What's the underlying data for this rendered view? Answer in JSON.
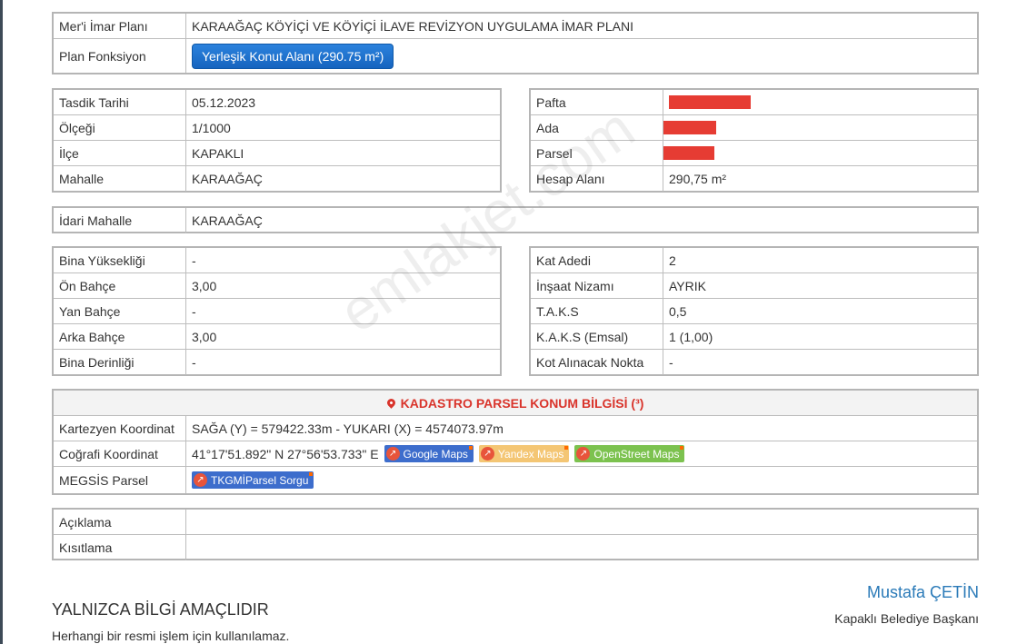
{
  "plan": {
    "name_label": "Mer'i İmar Planı",
    "name_value": "KARAAĞAÇ KÖYİÇİ VE KÖYİÇİ İLAVE REVİZYON UYGULAMA İMAR PLANI",
    "function_label": "Plan Fonksiyon",
    "function_button": "Yerleşik Konut Alanı (290.75 m²)"
  },
  "info_left": [
    {
      "label": "Tasdik Tarihi",
      "value": "05.12.2023"
    },
    {
      "label": "Ölçeği",
      "value": "1/1000"
    },
    {
      "label": "İlçe",
      "value": "KAPAKLI"
    },
    {
      "label": "Mahalle",
      "value": "KARAAĞAÇ"
    }
  ],
  "info_right": [
    {
      "label": "Pafta",
      "value": "",
      "redacted": true
    },
    {
      "label": "Ada",
      "value": "",
      "redacted": true
    },
    {
      "label": "Parsel",
      "value": "",
      "redacted": true
    },
    {
      "label": "Hesap Alanı",
      "value": "290,75 m²"
    }
  ],
  "idari": {
    "label": "İdari Mahalle",
    "value": "KARAAĞAÇ"
  },
  "build_left": [
    {
      "label": "Bina Yüksekliği",
      "value": "-"
    },
    {
      "label": "Ön Bahçe",
      "value": "3,00"
    },
    {
      "label": "Yan Bahçe",
      "value": "-"
    },
    {
      "label": "Arka Bahçe",
      "value": "3,00"
    },
    {
      "label": "Bina Derinliği",
      "value": "-"
    }
  ],
  "build_right": [
    {
      "label": "Kat Adedi",
      "value": "2"
    },
    {
      "label": "İnşaat Nizamı",
      "value": "AYRIK"
    },
    {
      "label": "T.A.K.S",
      "value": "0,5"
    },
    {
      "label": "K.A.K.S (Emsal)",
      "value": "1 (1,00)"
    },
    {
      "label": "Kot Alınacak Nokta",
      "value": "-"
    }
  ],
  "cadastre": {
    "header": "KADASTRO PARSEL KONUM BİLGİSİ (³)",
    "cartesian_label": "Kartezyen Koordinat",
    "cartesian_value": "SAĞA (Y) = 579422.33m - YUKARI (X) = 4574073.97m",
    "geo_label": "Coğrafi Koordinat",
    "geo_value": "41°17'51.892\" N 27°56'53.733\" E",
    "map_buttons": [
      "Google Maps",
      "Yandex Maps",
      "OpenStreet Maps"
    ],
    "megsis_label": "MEGSİS Parsel",
    "megsis_button": "TKGMİParsel Sorgu"
  },
  "notes": [
    {
      "label": "Açıklama",
      "value": ""
    },
    {
      "label": "Kısıtlama",
      "value": ""
    }
  ],
  "footer": {
    "disclaimer_title": "YALNIZCA BİLGİ AMAÇLIDIR",
    "disclaimer_sub": "Herhangi bir resmi işlem için kullanılamaz.",
    "signer_name": "Mustafa ÇETİN",
    "signer_title": "Kapaklı Belediye Başkanı"
  },
  "watermark": "emlakjet.com",
  "colors": {
    "primary_button": "#1a6fd1",
    "redaction": "#e63c33",
    "header_red": "#d9342b",
    "signer_blue": "#2a7ab8"
  }
}
